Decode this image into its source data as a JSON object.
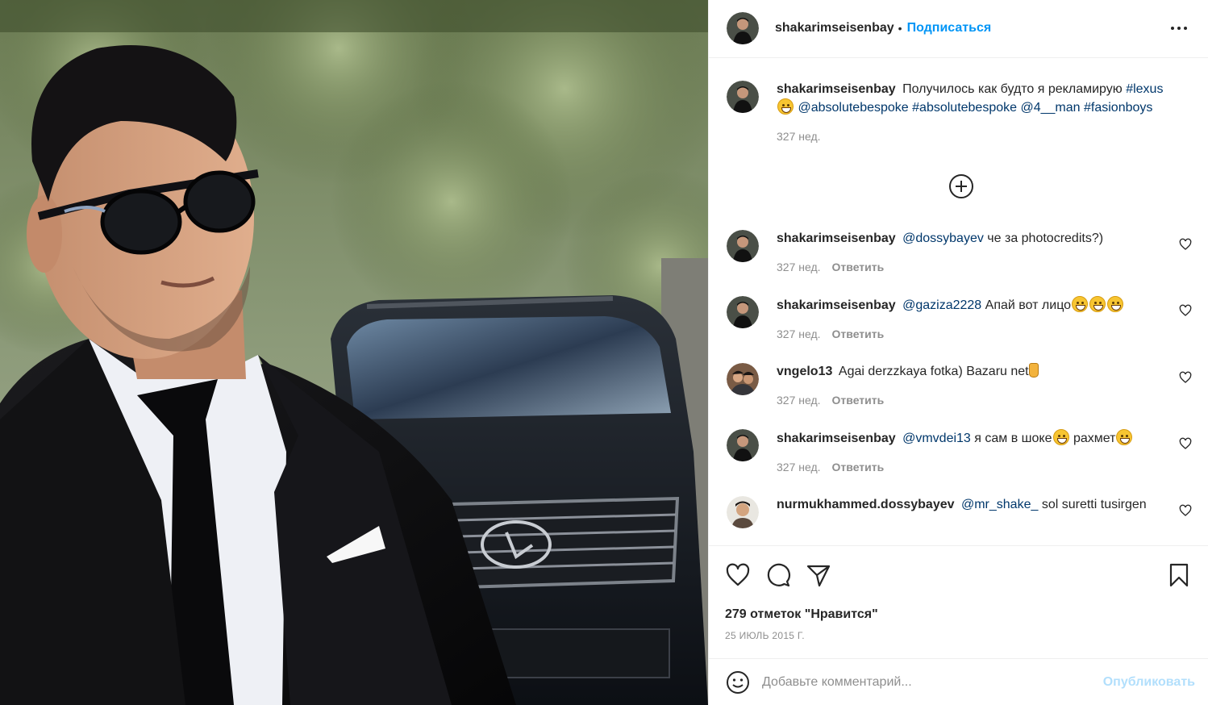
{
  "post": {
    "author": "shakarimseisenbay",
    "dot": "•",
    "follow_label": "Подписаться",
    "more_icon": "more-horizontal-icon"
  },
  "caption": {
    "username": "shakarimseisenbay",
    "text": "Получилось как будто я рекламирую",
    "tag_lexus": "#lexus",
    "mention1": "@absolutebespoke",
    "tag2": "#absolutebespoke",
    "mention2": "@4__man",
    "tag3": "#fasionboys",
    "time": "327 нед."
  },
  "add_replies_icon": "plus-circle-icon",
  "comments": [
    {
      "username": "shakarimseisenbay",
      "mention": "@dossybayev",
      "text": "че за photocredits?)",
      "time": "327 нед.",
      "reply": "Ответить"
    },
    {
      "username": "shakarimseisenbay",
      "mention": "@gaziza2228",
      "text": "Апай вот лицо",
      "time": "327 нед.",
      "reply": "Ответить"
    },
    {
      "username": "vngelo13",
      "mention": "",
      "text": "Agai derzzkaya fotka) Bazaru net",
      "time": "327 нед.",
      "reply": "Ответить"
    },
    {
      "username": "shakarimseisenbay",
      "mention": "@vmvdei13",
      "text": "я сам в шоке",
      "text2": "рахмет",
      "time": "327 нед.",
      "reply": "Ответить"
    },
    {
      "username": "nurmukhammed.dossybayev",
      "mention": "@mr_shake_",
      "text": "sol suretti tusirgen",
      "time": "",
      "reply": ""
    }
  ],
  "likes": "279 отметок \"Нравится\"",
  "date": "25 ИЮЛЬ 2015 Г.",
  "compose": {
    "placeholder": "Добавьте комментарий...",
    "publish": "Опубликовать"
  },
  "colors": {
    "link_blue": "#0095f6",
    "mention_blue": "#00376b",
    "meta_gray": "#8e8e8e",
    "publish_disabled": "#b2dffc"
  }
}
